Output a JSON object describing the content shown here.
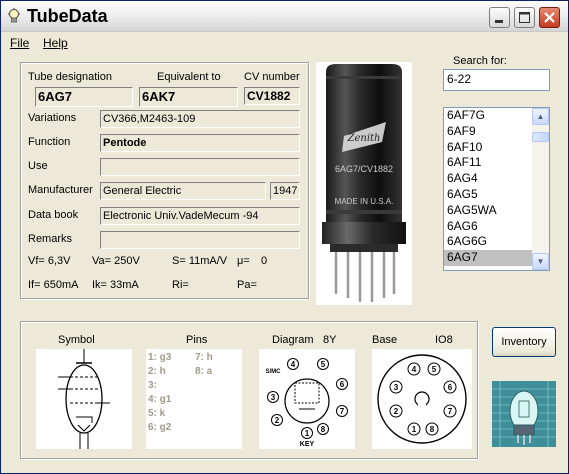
{
  "window": {
    "title": "TubeData"
  },
  "menu": {
    "file": "File",
    "help": "Help"
  },
  "tube": {
    "designation_label": "Tube designation",
    "equivalent_label": "Equivalent to",
    "cv_label": "CV number",
    "designation": "6AG7",
    "equivalent": "6AK7",
    "cv": "CV1882",
    "variations_label": "Variations",
    "variations": "CV366,M2463-109",
    "function_label": "Function",
    "function": "Pentode",
    "use_label": "Use",
    "use": "",
    "manufacturer_label": "Manufacturer",
    "manufacturer": "General Electric",
    "year": "1947",
    "databook_label": "Data book",
    "databook": "Electronic Univ.VadeMecum -94",
    "remarks_label": "Remarks",
    "remarks": "",
    "vf": "Vf= 6,3V",
    "va": "Va= 250V",
    "s": "S= 11mA/V",
    "mu": "μ=",
    "mu_val": "0",
    "if": "If= 650mA",
    "ik": "Ik= 33mA",
    "ri": "Ri=",
    "pa": "Pa="
  },
  "photo": {
    "line1": "6AG7/CV1882",
    "line2": "MADE IN U.S.A.",
    "brand": "Zenith"
  },
  "search": {
    "label": "Search for:",
    "value": "6-22",
    "items": [
      "6AF7G",
      "6AF9",
      "6AF10",
      "6AF11",
      "6AG4",
      "6AG5",
      "6AG5WA",
      "6AG6",
      "6AG6G",
      "6AG7"
    ],
    "selected": "6AG7"
  },
  "lower": {
    "symbol_label": "Symbol",
    "pins_label": "Pins",
    "diagram_label": "Diagram",
    "diagram_code": "8Y",
    "base_label": "Base",
    "base_code": "IO8",
    "pins_left": [
      "1: g3",
      "2: h",
      "3:",
      "4: g1",
      "5: k",
      "6: g2"
    ],
    "pins_right": [
      "7: h",
      "8: a"
    ],
    "diagram_pins": [
      "1",
      "2",
      "3",
      "4",
      "5",
      "6",
      "7",
      "8"
    ],
    "diagram_extra": {
      "shell": "S/MC",
      "key": "KEY"
    }
  },
  "buttons": {
    "inventory": "Inventory"
  }
}
